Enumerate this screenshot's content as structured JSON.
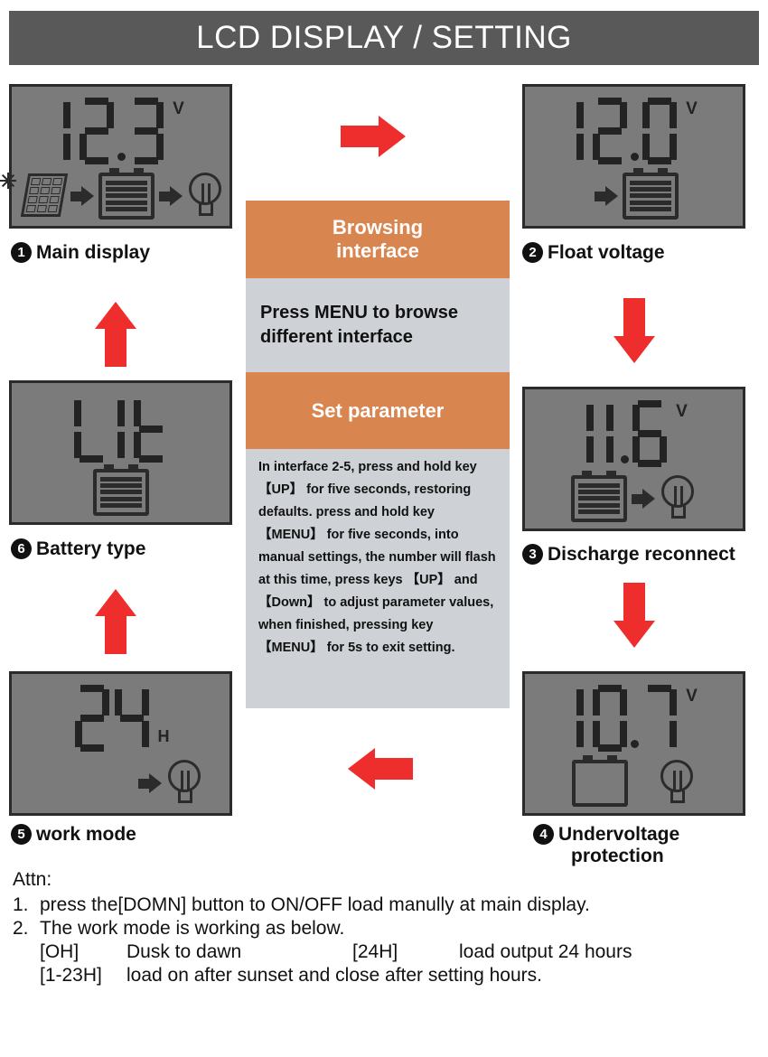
{
  "header": {
    "title": "LCD DISPLAY / SETTING"
  },
  "panels": {
    "p1": {
      "number": "1",
      "caption": "Main display",
      "value": "12.3",
      "unit": "V",
      "icons": [
        "solar-panel-icon",
        "arrow-icon",
        "battery-full-icon",
        "arrow-icon",
        "lamp-icon"
      ]
    },
    "p2": {
      "number": "2",
      "caption": "Float voltage",
      "value": "12.0",
      "unit": "V",
      "icons": [
        "arrow-icon",
        "battery-full-icon"
      ]
    },
    "p3": {
      "number": "3",
      "caption": "Discharge reconnect",
      "value": "11.6",
      "unit": "V",
      "icons": [
        "battery-full-icon",
        "arrow-icon",
        "lamp-icon"
      ]
    },
    "p4": {
      "number": "4",
      "caption_line1": "Undervoltage",
      "caption_line2": "protection",
      "value": "10.7",
      "unit": "V",
      "icons": [
        "battery-empty-icon",
        "lamp-icon"
      ]
    },
    "p5": {
      "number": "5",
      "caption": "work mode",
      "value": "24",
      "unit": "H",
      "icons": [
        "arrow-icon",
        "lamp-icon"
      ]
    },
    "p6": {
      "number": "6",
      "caption": "Battery type",
      "value": "LIt",
      "unit": "",
      "icons": [
        "battery-full-icon"
      ]
    }
  },
  "center": {
    "browsing_title_line1": "Browsing",
    "browsing_title_line2": "interface",
    "browse_hint": "Press MENU to browse different interface",
    "set_parameter_title": "Set parameter",
    "set_parameter_note": "In interface 2-5, press and hold key 【UP】 for five seconds, restoring defaults. press and hold  key 【MENU】 for five seconds, into manual settings, the number will flash at this time, press keys 【UP】 and 【Down】 to adjust  parameter values, when finished, pressing  key 【MENU】 for 5s to exit  setting."
  },
  "notes": {
    "attn_label": "Attn:",
    "item1_num": "1.",
    "item1_text": "press the[DOMN] button to ON/OFF load manully at main display.",
    "item2_num": "2.",
    "item2_text": "The work mode is working as below.",
    "mode1_key": "[OH]",
    "mode1_value": "Dusk to dawn",
    "mode2_key": "[24H]",
    "mode2_value": "load output 24 hours",
    "mode3_key": "[1-23H]",
    "mode3_value": "load on after sunset and close after setting hours."
  },
  "colors": {
    "title_bar": "#595959",
    "lcd_background": "#7b7b7b",
    "lcd_segment": "#232323",
    "arrow_red": "#ee2d2d",
    "band_orange": "#d98550",
    "band_gray": "#ced2d6"
  },
  "flow_arrows": [
    {
      "name": "arrow-p1-to-p2",
      "direction": "right"
    },
    {
      "name": "arrow-p2-to-p3",
      "direction": "down"
    },
    {
      "name": "arrow-p3-to-p4",
      "direction": "down"
    },
    {
      "name": "arrow-p4-to-p5",
      "direction": "left"
    },
    {
      "name": "arrow-p5-to-p6",
      "direction": "up"
    },
    {
      "name": "arrow-p6-to-p1",
      "direction": "up"
    }
  ]
}
